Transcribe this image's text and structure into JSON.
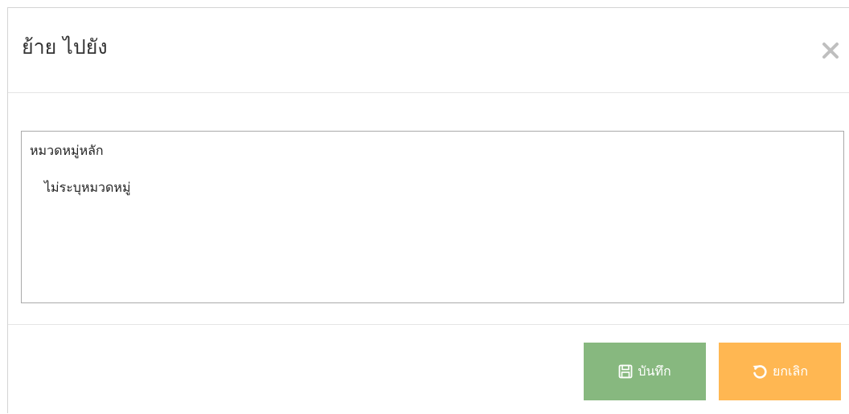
{
  "dialog": {
    "title": "ย้าย ไปยัง",
    "close_icon": "close-icon"
  },
  "tree": {
    "root_label": "หมวดหมู่หลัก",
    "items": [
      {
        "label": "ไม่ระบุหมวดหมู่"
      }
    ]
  },
  "footer": {
    "save_label": "บันทึก",
    "save_icon": "floppy-disk-icon",
    "save_color": "#87b87f",
    "cancel_label": "ยกเลิก",
    "cancel_icon": "undo-icon",
    "cancel_color": "#ffb752"
  }
}
